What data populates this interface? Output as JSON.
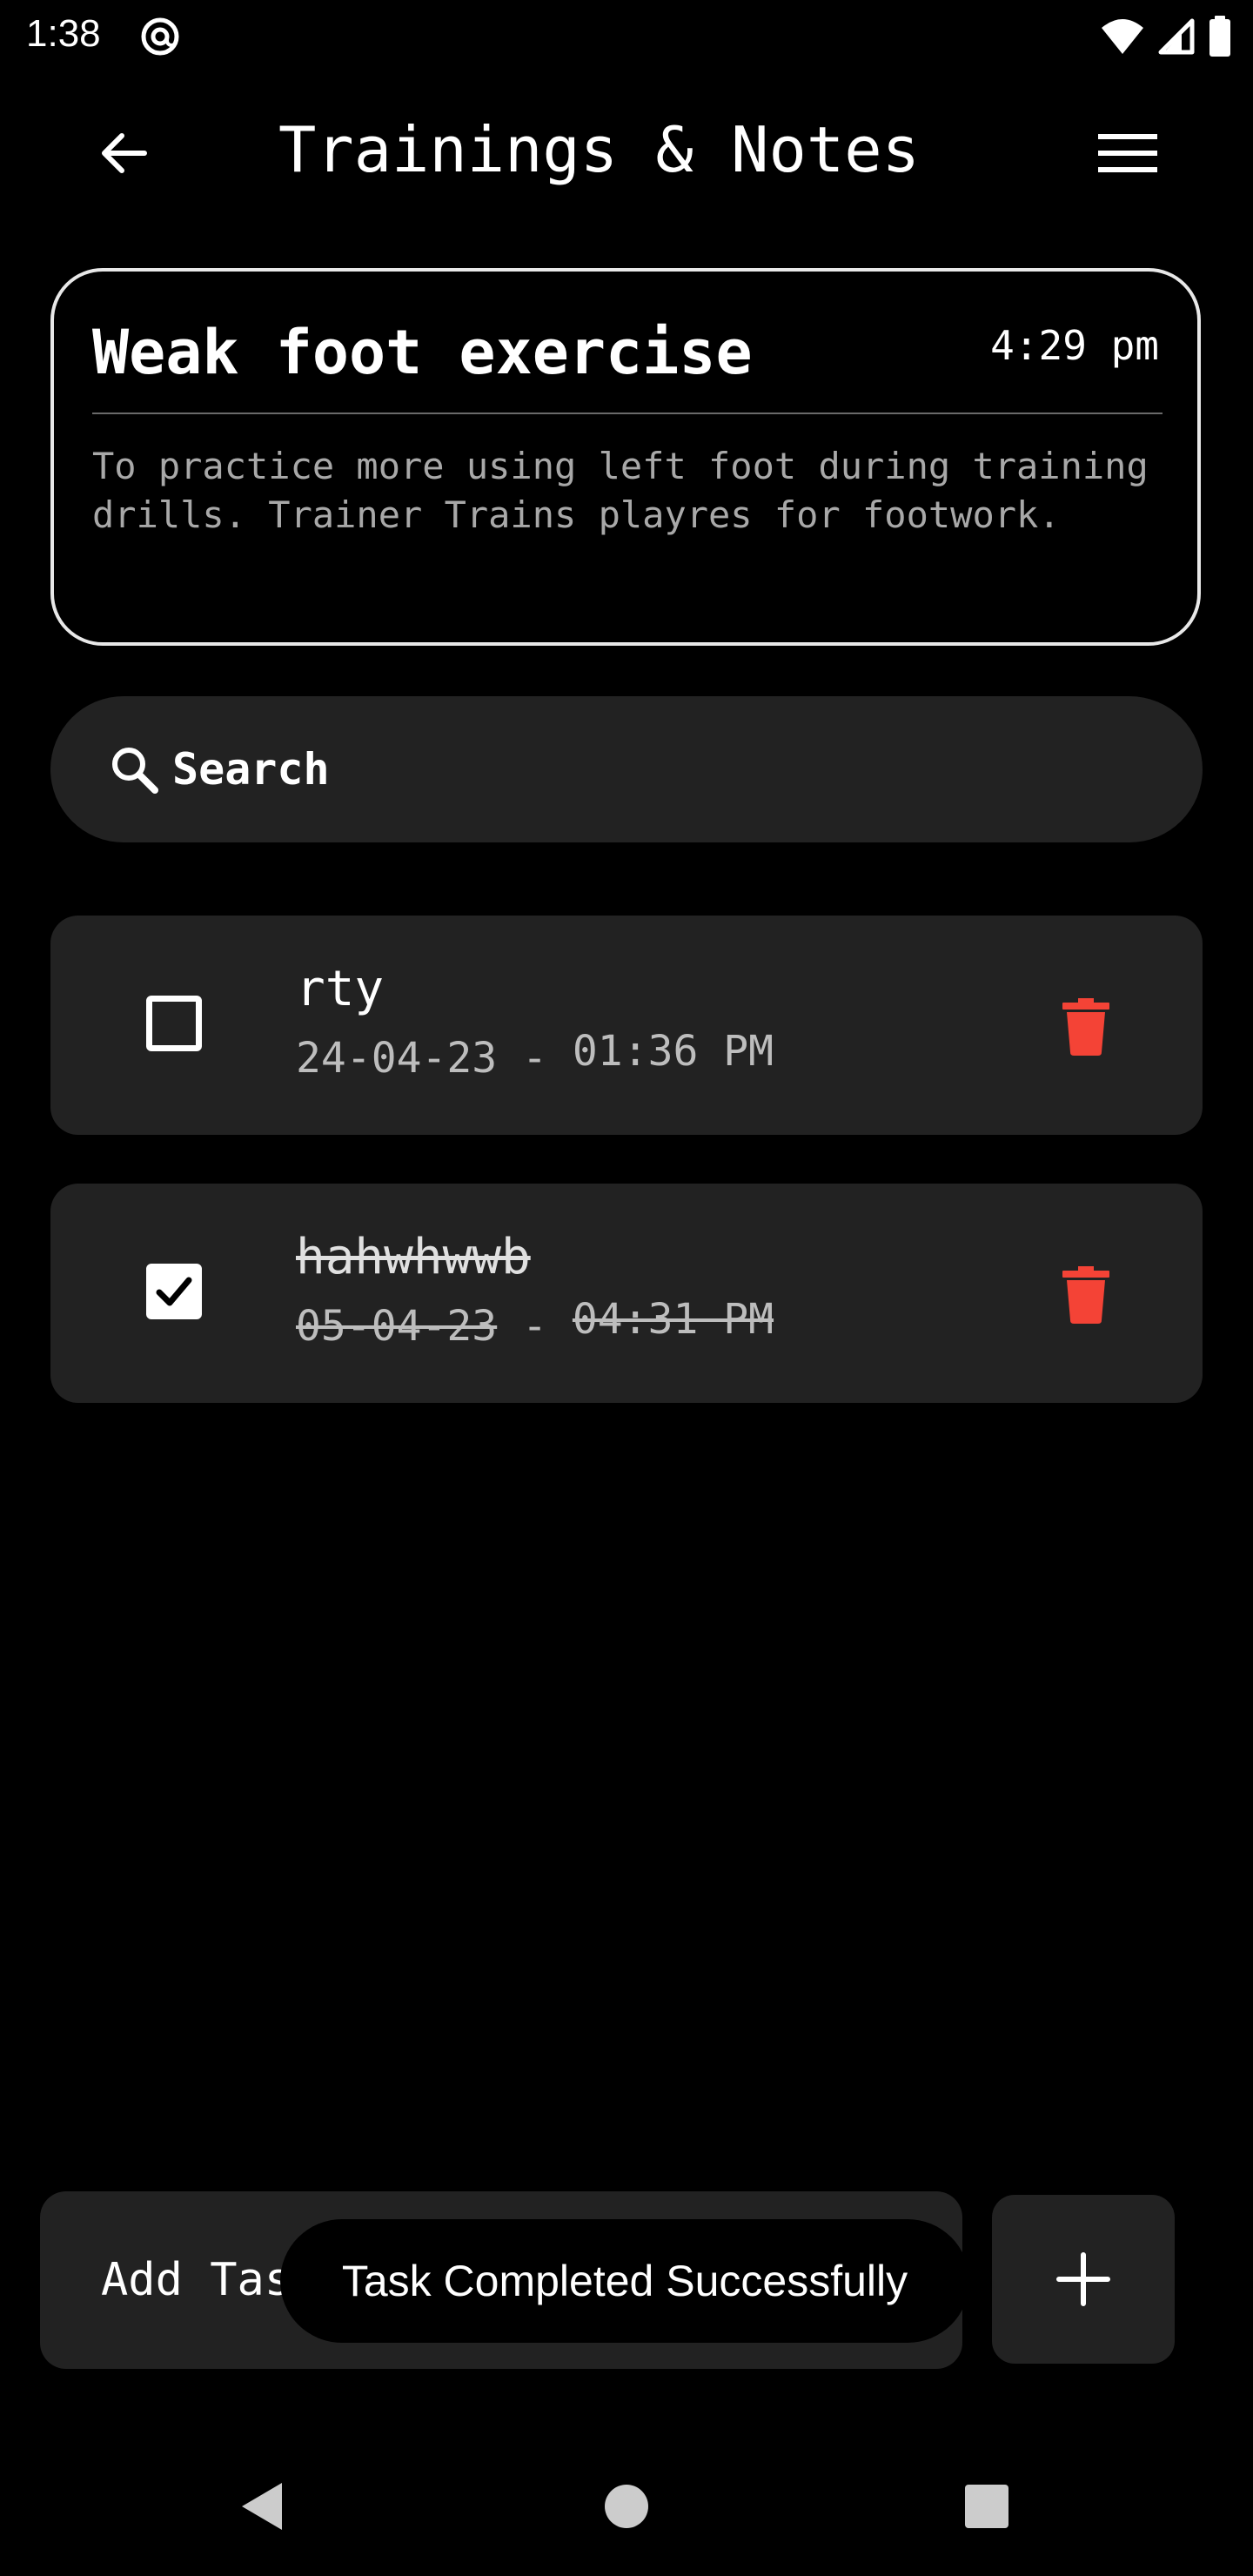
{
  "status_bar": {
    "time": "1:38",
    "icons": [
      "at-sign-icon",
      "wifi-icon",
      "signal-icon",
      "battery-icon"
    ]
  },
  "app_bar": {
    "title": "Trainings & Notes",
    "back_icon": "arrow-left-icon",
    "menu_icon": "hamburger-menu-icon"
  },
  "note": {
    "title": "Weak foot exercise",
    "time": "4:29 pm",
    "body": "To practice more using left foot during training drills. Trainer Trains playres for footwork."
  },
  "search": {
    "placeholder": "Search",
    "icon": "search-icon"
  },
  "tasks": [
    {
      "name": "rty",
      "date": "24-04-23",
      "separator": " - ",
      "time": "01:36 PM",
      "completed": false
    },
    {
      "name": "hahwhwwb",
      "date": "05-04-23",
      "separator": " - ",
      "time": "04:31 PM",
      "completed": true
    }
  ],
  "add_task": {
    "placeholder": "Add Task",
    "button_icon": "plus-icon"
  },
  "toast": {
    "message": "Task Completed Successfully"
  },
  "colors": {
    "background": "#000000",
    "card": "#222222",
    "delete": "#f44336",
    "text": "#ffffff",
    "muted": "#bdbdbd"
  },
  "nav_bar": {
    "icons": [
      "nav-back-icon",
      "nav-home-icon",
      "nav-recents-icon"
    ]
  }
}
